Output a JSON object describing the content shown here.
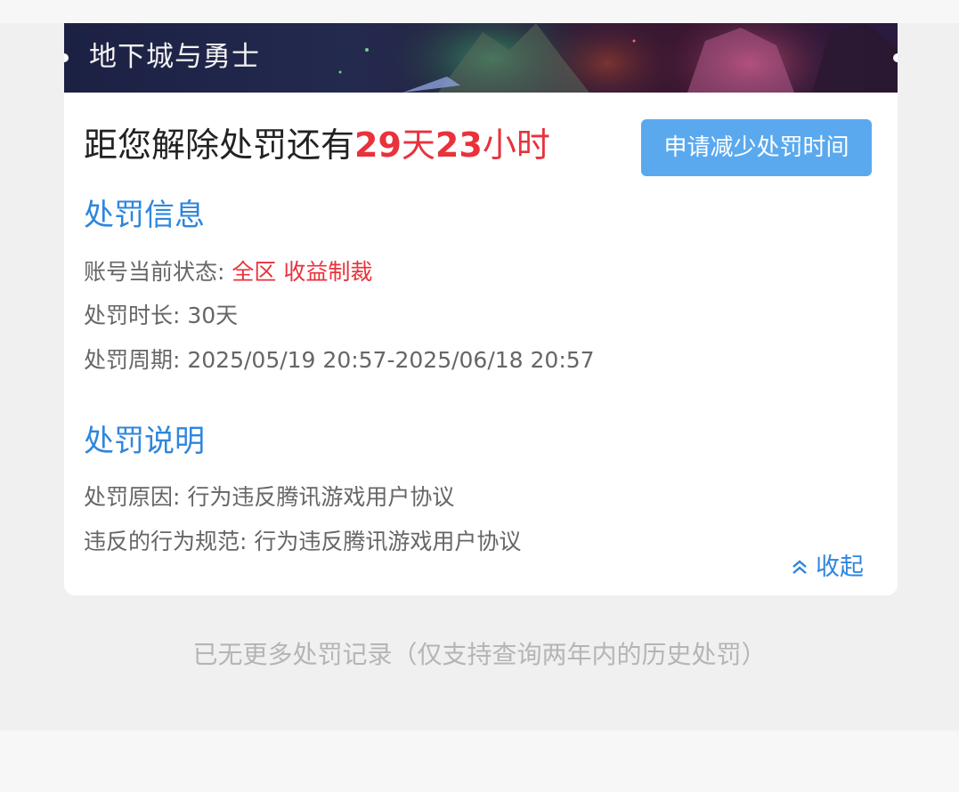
{
  "banner": {
    "title": "地下城与勇士"
  },
  "countdown": {
    "prefix": "距您解除处罚还有",
    "days": "29",
    "days_unit": "天",
    "hours": "23",
    "hours_unit": "小时"
  },
  "apply_button": {
    "label": "申请减少处罚时间"
  },
  "penalty_info": {
    "title": "处罚信息",
    "status_label": "账号当前状态: ",
    "status_scope": "全区",
    "status_type": "收益制裁",
    "duration_label": "处罚时长: ",
    "duration_value": "30天",
    "period_label": "处罚周期: ",
    "period_value": "2025/05/19 20:57-2025/06/18 20:57"
  },
  "penalty_desc": {
    "title": "处罚说明",
    "reason_label": "处罚原因: ",
    "reason_value": "行为违反腾讯游戏用户协议",
    "rule_label": "违反的行为规范: ",
    "rule_value": "行为违反腾讯游戏用户协议"
  },
  "collapse": {
    "label": "收起"
  },
  "footer": {
    "note": "已无更多处罚记录（仅支持查询两年内的历史处罚）"
  },
  "colors": {
    "accent_blue": "#2f86dc",
    "button_blue": "#5aa9ef",
    "alert_red": "#e8323c"
  },
  "icons": {
    "collapse": "double-chevron-up-icon"
  }
}
